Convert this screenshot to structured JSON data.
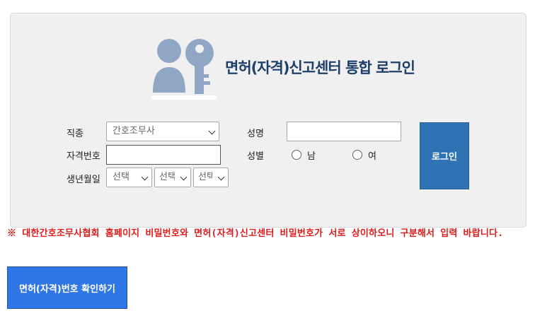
{
  "page": {
    "title": "면허(자격)신고센터 통합 로그인"
  },
  "form": {
    "job_label": "직종",
    "job_value": "간호조무사",
    "license_label": "자격번호",
    "license_value": "",
    "birth_label": "생년월일",
    "birth_year": "선택",
    "birth_month": "선택",
    "birth_day": "선택",
    "name_label": "성명",
    "name_value": "",
    "gender_label": "성별",
    "gender_male": "남",
    "gender_female": "여",
    "login_button": "로그인"
  },
  "notice": {
    "text": "※ 대한간호조무사협회 홈페이지 비밀번호와 면허(자격)신고센터 비밀번호가 서로 상이하오니 구분해서 입력 바랍니다."
  },
  "confirm_button": {
    "label": "면허(자격)번호 확인하기"
  },
  "colors": {
    "accent": "#2f73b5",
    "notice": "#e01a1a",
    "panel_bg": "#f0f0f1",
    "icon": "#8fa6c4"
  }
}
